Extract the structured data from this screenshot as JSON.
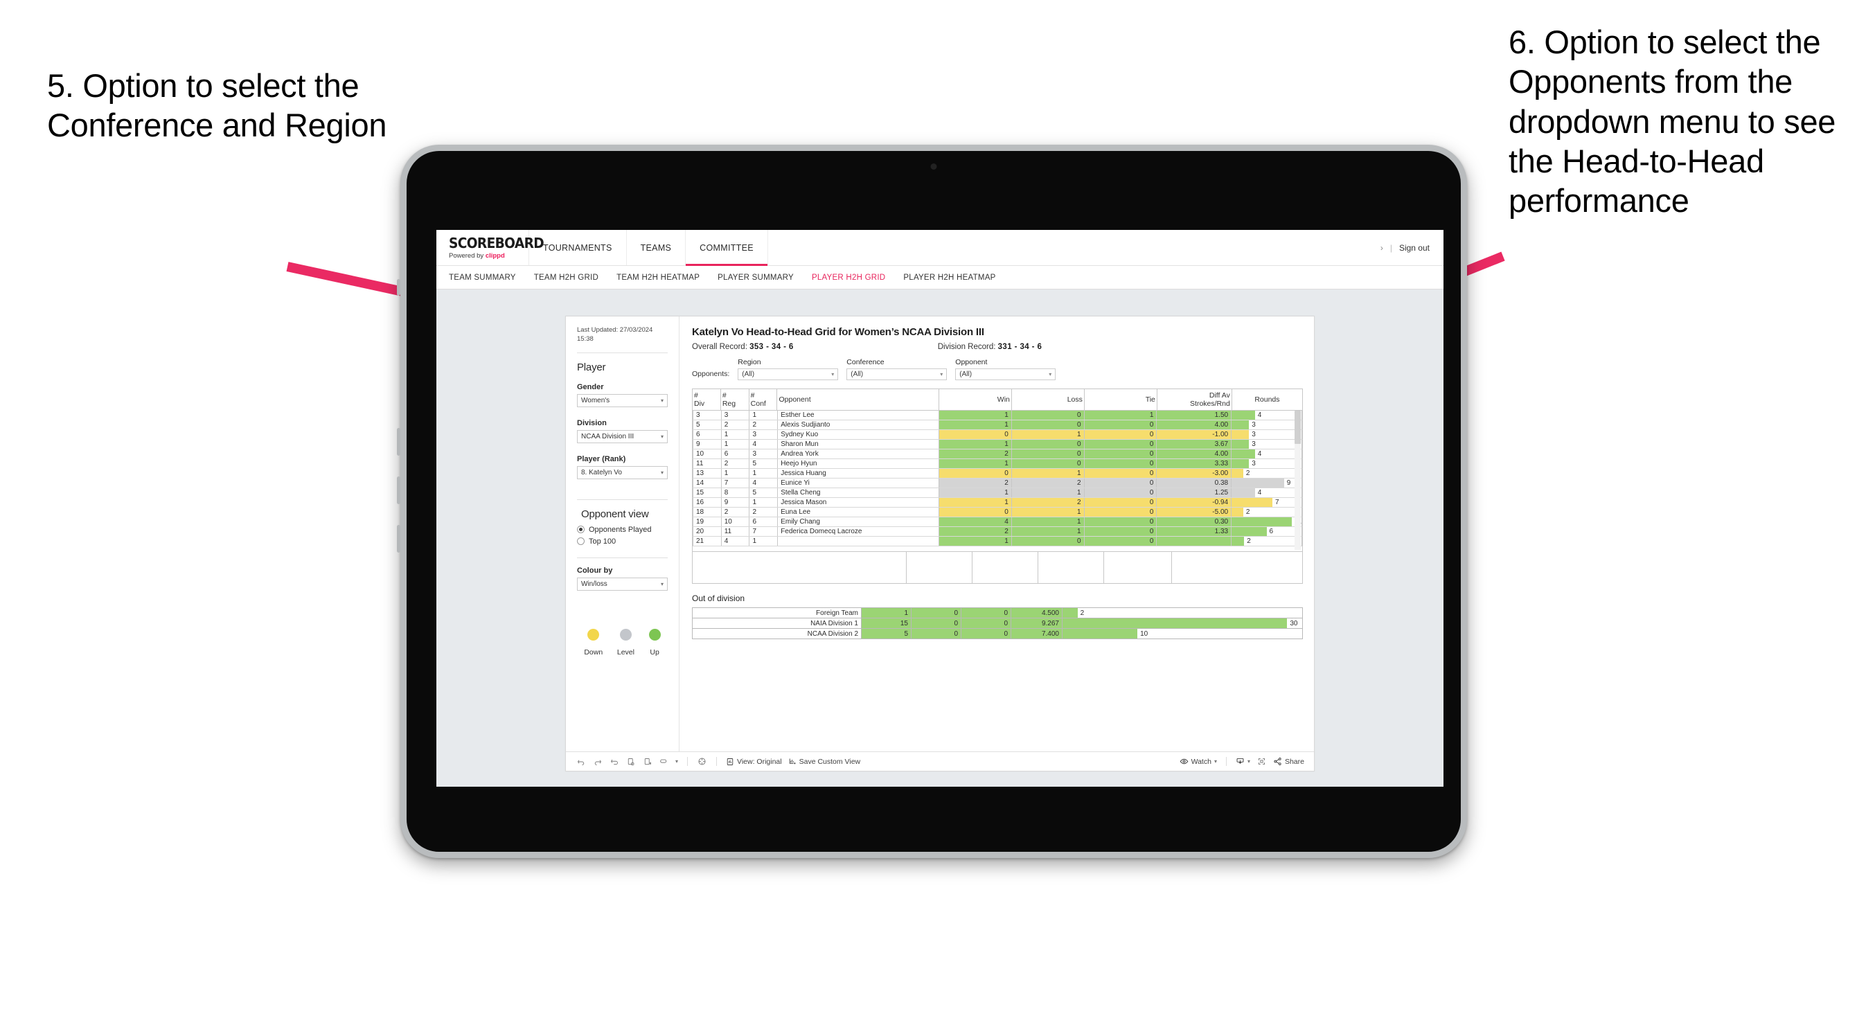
{
  "annotations": {
    "left": "5. Option to select the Conference and Region",
    "right": "6. Option to select the Opponents from the dropdown menu to see the Head-to-Head performance",
    "arrow_color": "#ea2a63"
  },
  "header": {
    "brand_name": "SCOREBOARD",
    "brand_powered_prefix": "Powered by ",
    "brand_powered_name": "clippd",
    "nav": [
      {
        "label": "TOURNAMENTS",
        "active": false
      },
      {
        "label": "TEAMS",
        "active": false
      },
      {
        "label": "COMMITTEE",
        "active": true
      }
    ],
    "chevron": "›",
    "divider": "|",
    "sign_out": "Sign out",
    "accent_color": "#e8245c"
  },
  "subnav": {
    "items": [
      {
        "label": "TEAM SUMMARY",
        "active": false
      },
      {
        "label": "TEAM H2H GRID",
        "active": false
      },
      {
        "label": "TEAM H2H HEATMAP",
        "active": false
      },
      {
        "label": "PLAYER SUMMARY",
        "active": false
      },
      {
        "label": "PLAYER H2H GRID",
        "active": true
      },
      {
        "label": "PLAYER H2H HEATMAP",
        "active": false
      }
    ]
  },
  "sidebar": {
    "last_updated": "Last Updated: 27/03/2024 15:38",
    "section_player": "Player",
    "fields": [
      {
        "label": "Gender",
        "value": "Women's"
      },
      {
        "label": "Division",
        "value": "NCAA Division III"
      },
      {
        "label": "Player (Rank)",
        "value": "8. Katelyn Vo"
      }
    ],
    "opponent_view_title": "Opponent view",
    "opponent_view_options": [
      {
        "label": "Opponents Played",
        "selected": true
      },
      {
        "label": "Top 100",
        "selected": false
      }
    ],
    "colour_by_label": "Colour by",
    "colour_by_value": "Win/loss",
    "legend": [
      {
        "label": "Down",
        "color": "#f2d64b"
      },
      {
        "label": "Level",
        "color": "#c3c6cb"
      },
      {
        "label": "Up",
        "color": "#7dc552"
      }
    ]
  },
  "main": {
    "title": "Katelyn Vo Head-to-Head Grid for Women’s NCAA Division III",
    "overall_record_label": "Overall Record: ",
    "overall_record_value": "353 - 34 - 6",
    "division_record_label": "Division Record: ",
    "division_record_value": "331 - 34 - 6",
    "filters_label": "Opponents:",
    "filters": [
      {
        "name": "Region",
        "value": "(All)"
      },
      {
        "name": "Conference",
        "value": "(All)"
      },
      {
        "name": "Opponent",
        "value": "(All)"
      }
    ]
  },
  "chart_data": {
    "type": "table",
    "title": "Katelyn Vo Head-to-Head Grid for Women’s NCAA Division III",
    "columns": [
      "# Div",
      "# Reg",
      "# Conf",
      "Opponent",
      "Win",
      "Loss",
      "Tie",
      "Diff Av Strokes/Rnd",
      "Rounds"
    ],
    "header_lines": [
      [
        "#",
        "Div"
      ],
      [
        "#",
        "Reg"
      ],
      [
        "#",
        "Conf"
      ],
      [
        "Opponent"
      ],
      [
        "Win"
      ],
      [
        "Loss"
      ],
      [
        "Tie"
      ],
      [
        "Diff Av",
        "Strokes/Rnd"
      ],
      [
        "Rounds"
      ]
    ],
    "rounds_max": 12,
    "rows": [
      {
        "div": "3",
        "reg": "3",
        "conf": "1",
        "opponent": "Esther Lee",
        "win": "1",
        "loss": "0",
        "tie": "1",
        "diff": "1.50",
        "rounds": "4",
        "rounds_n": 4,
        "color": "green"
      },
      {
        "div": "5",
        "reg": "2",
        "conf": "2",
        "opponent": "Alexis Sudjianto",
        "win": "1",
        "loss": "0",
        "tie": "0",
        "diff": "4.00",
        "rounds": "3",
        "rounds_n": 3,
        "color": "green"
      },
      {
        "div": "6",
        "reg": "1",
        "conf": "3",
        "opponent": "Sydney Kuo",
        "win": "0",
        "loss": "1",
        "tie": "0",
        "diff": "-1.00",
        "rounds": "3",
        "rounds_n": 3,
        "color": "yellow"
      },
      {
        "div": "9",
        "reg": "1",
        "conf": "4",
        "opponent": "Sharon Mun",
        "win": "1",
        "loss": "0",
        "tie": "0",
        "diff": "3.67",
        "rounds": "3",
        "rounds_n": 3,
        "color": "green"
      },
      {
        "div": "10",
        "reg": "6",
        "conf": "3",
        "opponent": "Andrea York",
        "win": "2",
        "loss": "0",
        "tie": "0",
        "diff": "4.00",
        "rounds": "4",
        "rounds_n": 4,
        "color": "green"
      },
      {
        "div": "11",
        "reg": "2",
        "conf": "5",
        "opponent": "Heejo Hyun",
        "win": "1",
        "loss": "0",
        "tie": "0",
        "diff": "3.33",
        "rounds": "3",
        "rounds_n": 3,
        "color": "green"
      },
      {
        "div": "13",
        "reg": "1",
        "conf": "1",
        "opponent": "Jessica Huang",
        "win": "0",
        "loss": "1",
        "tie": "0",
        "diff": "-3.00",
        "rounds": "2",
        "rounds_n": 2,
        "color": "yellow"
      },
      {
        "div": "14",
        "reg": "7",
        "conf": "4",
        "opponent": "Eunice Yi",
        "win": "2",
        "loss": "2",
        "tie": "0",
        "diff": "0.38",
        "rounds": "9",
        "rounds_n": 9,
        "color": "grey"
      },
      {
        "div": "15",
        "reg": "8",
        "conf": "5",
        "opponent": "Stella Cheng",
        "win": "1",
        "loss": "1",
        "tie": "0",
        "diff": "1.25",
        "rounds": "4",
        "rounds_n": 4,
        "color": "grey"
      },
      {
        "div": "16",
        "reg": "9",
        "conf": "1",
        "opponent": "Jessica Mason",
        "win": "1",
        "loss": "2",
        "tie": "0",
        "diff": "-0.94",
        "rounds": "7",
        "rounds_n": 7,
        "color": "yellow"
      },
      {
        "div": "18",
        "reg": "2",
        "conf": "2",
        "opponent": "Euna Lee",
        "win": "0",
        "loss": "1",
        "tie": "0",
        "diff": "-5.00",
        "rounds": "2",
        "rounds_n": 2,
        "color": "yellow"
      },
      {
        "div": "19",
        "reg": "10",
        "conf": "6",
        "opponent": "Emily Chang",
        "win": "4",
        "loss": "1",
        "tie": "0",
        "diff": "0.30",
        "rounds": "11",
        "rounds_n": 11,
        "color": "green"
      },
      {
        "div": "20",
        "reg": "11",
        "conf": "7",
        "opponent": "Federica Domecq Lacroze",
        "win": "2",
        "loss": "1",
        "tie": "0",
        "diff": "1.33",
        "rounds": "6",
        "rounds_n": 6,
        "color": "green"
      }
    ],
    "out_of_division": {
      "title": "Out of division",
      "rounds_max": 32,
      "rows": [
        {
          "name": "Foreign Team",
          "win": "1",
          "loss": "0",
          "tie": "0",
          "diff": "4.500",
          "rounds": "2",
          "rounds_n": 2,
          "color": "green"
        },
        {
          "name": "NAIA Division 1",
          "win": "15",
          "loss": "0",
          "tie": "0",
          "diff": "9.267",
          "rounds": "30",
          "rounds_n": 30,
          "color": "green"
        },
        {
          "name": "NCAA Division 2",
          "win": "5",
          "loss": "0",
          "tie": "0",
          "diff": "7.400",
          "rounds": "10",
          "rounds_n": 10,
          "color": "green"
        }
      ]
    },
    "colors": {
      "green": "#9bd474",
      "yellow": "#f6dd6d",
      "grey": "#d4d4d4"
    }
  },
  "toolbar": {
    "view_label": "View: Original",
    "save_label": "Save Custom View",
    "watch_label": "Watch",
    "share_label": "Share",
    "caret": "▾"
  }
}
